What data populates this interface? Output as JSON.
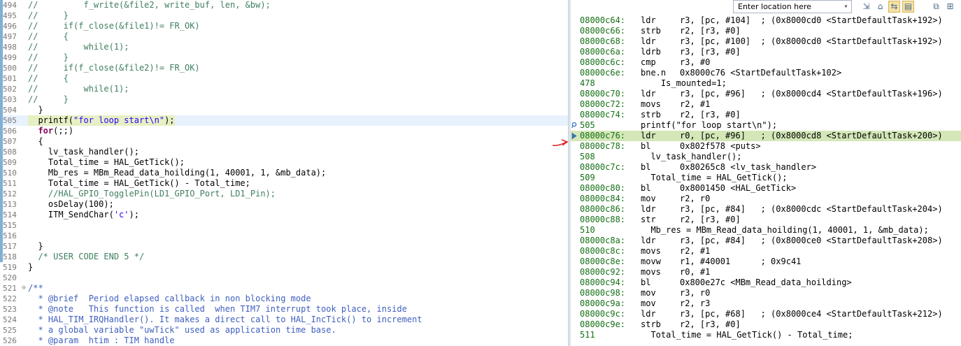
{
  "editor": {
    "lines": [
      {
        "n": "494",
        "bar": true,
        "parts": [
          {
            "c": "cm",
            "t": "//"
          },
          {
            "c": "cm",
            "t": "         f_write(&file2, write_buf, len, &bw);"
          }
        ]
      },
      {
        "n": "495",
        "bar": true,
        "parts": [
          {
            "c": "cm",
            "t": "//     }"
          }
        ]
      },
      {
        "n": "496",
        "bar": true,
        "parts": [
          {
            "c": "cm",
            "t": "//     if(f_close(&file1)!= FR_OK)"
          }
        ]
      },
      {
        "n": "497",
        "bar": true,
        "parts": [
          {
            "c": "cm",
            "t": "//     {"
          }
        ]
      },
      {
        "n": "498",
        "bar": true,
        "parts": [
          {
            "c": "cm",
            "t": "//         while(1);"
          }
        ]
      },
      {
        "n": "499",
        "bar": true,
        "parts": [
          {
            "c": "cm",
            "t": "//     }"
          }
        ]
      },
      {
        "n": "500",
        "bar": true,
        "parts": [
          {
            "c": "cm",
            "t": "//     if(f_close(&file2)!= FR_OK)"
          }
        ]
      },
      {
        "n": "501",
        "bar": true,
        "parts": [
          {
            "c": "cm",
            "t": "//     {"
          }
        ]
      },
      {
        "n": "502",
        "bar": true,
        "parts": [
          {
            "c": "cm",
            "t": "//         while(1);"
          }
        ]
      },
      {
        "n": "503",
        "bar": true,
        "parts": [
          {
            "c": "cm",
            "t": "//     }"
          }
        ]
      },
      {
        "n": "504",
        "bar": true,
        "parts": [
          {
            "c": "plain",
            "t": "  }"
          }
        ]
      },
      {
        "n": "505",
        "bar": true,
        "current": true,
        "parts": [
          {
            "c": "plain",
            "t": "  printf("
          },
          {
            "c": "str",
            "t": "\"for loop start\\n\""
          },
          {
            "c": "plain",
            "t": ");"
          }
        ]
      },
      {
        "n": "506",
        "bar": true,
        "parts": [
          {
            "c": "plain",
            "t": "  "
          },
          {
            "c": "kw",
            "t": "for"
          },
          {
            "c": "plain",
            "t": "(;;)"
          }
        ]
      },
      {
        "n": "507",
        "bar": true,
        "parts": [
          {
            "c": "plain",
            "t": "  {"
          }
        ]
      },
      {
        "n": "508",
        "bar": true,
        "parts": [
          {
            "c": "plain",
            "t": "    lv_task_handler();"
          }
        ]
      },
      {
        "n": "509",
        "bar": true,
        "parts": [
          {
            "c": "plain",
            "t": "    Total_time = HAL_GetTick();"
          }
        ]
      },
      {
        "n": "510",
        "bar": true,
        "parts": [
          {
            "c": "plain",
            "t": "    Mb_res = MBm_Read_data_hoilding(1, 40001, 1, &mb_data);"
          }
        ]
      },
      {
        "n": "511",
        "bar": true,
        "parts": [
          {
            "c": "plain",
            "t": "    Total_time = HAL_GetTick() - Total_time;"
          }
        ]
      },
      {
        "n": "512",
        "bar": true,
        "parts": [
          {
            "c": "cm",
            "t": "    //HAL_GPIO_TogglePin(LD1_GPIO_Port, LD1_Pin);"
          }
        ]
      },
      {
        "n": "513",
        "bar": true,
        "parts": [
          {
            "c": "plain",
            "t": "    osDelay(100);"
          }
        ]
      },
      {
        "n": "514",
        "bar": true,
        "parts": [
          {
            "c": "plain",
            "t": "    ITM_SendChar("
          },
          {
            "c": "str",
            "t": "'c'"
          },
          {
            "c": "plain",
            "t": ");"
          }
        ]
      },
      {
        "n": "515",
        "bar": true,
        "parts": [
          {
            "c": "plain",
            "t": ""
          }
        ]
      },
      {
        "n": "516",
        "bar": true,
        "parts": [
          {
            "c": "plain",
            "t": ""
          }
        ]
      },
      {
        "n": "517",
        "bar": true,
        "parts": [
          {
            "c": "plain",
            "t": "  }"
          }
        ]
      },
      {
        "n": "518",
        "bar": true,
        "parts": [
          {
            "c": "cm",
            "t": "  /* USER CODE END 5 */"
          }
        ]
      },
      {
        "n": "519",
        "bar": false,
        "parts": [
          {
            "c": "plain",
            "t": "}"
          }
        ]
      },
      {
        "n": "520",
        "bar": false,
        "parts": [
          {
            "c": "plain",
            "t": ""
          }
        ]
      },
      {
        "n": "521",
        "bar": false,
        "fold": "⊖",
        "parts": [
          {
            "c": "doc",
            "t": "/**"
          }
        ]
      },
      {
        "n": "522",
        "bar": false,
        "parts": [
          {
            "c": "doc",
            "t": "  * @brief  Period elapsed callback in non blocking mode"
          }
        ]
      },
      {
        "n": "523",
        "bar": false,
        "parts": [
          {
            "c": "doc",
            "t": "  * @note   This function is called  when TIM7 interrupt took place, inside"
          }
        ]
      },
      {
        "n": "524",
        "bar": false,
        "parts": [
          {
            "c": "doc",
            "t": "  * HAL_TIM_IRQHandler(). It makes a direct call to HAL_IncTick() to increment"
          }
        ]
      },
      {
        "n": "525",
        "bar": false,
        "parts": [
          {
            "c": "doc",
            "t": "  * a global variable \"uwTick\" used as application time base."
          }
        ]
      },
      {
        "n": "526",
        "bar": false,
        "parts": [
          {
            "c": "doc",
            "t": "  * @param  htim : TIM handle"
          }
        ]
      }
    ]
  },
  "disasm": {
    "location_placeholder": "Enter location here",
    "toolbar_icons": [
      "goto-address-icon",
      "home-icon",
      "link-with-editor-icon",
      "show-source-icon",
      "new-view-icon",
      "pin-icon"
    ],
    "lines": [
      {
        "type": "asm",
        "addr": "08000c64:",
        "mn": "ldr",
        "ops": "r3, [pc, #104]  ; (0x8000cd0 <StartDefaultTask+192>)"
      },
      {
        "type": "asm",
        "addr": "08000c66:",
        "mn": "strb",
        "ops": "r2, [r3, #0]"
      },
      {
        "type": "asm",
        "addr": "08000c68:",
        "mn": "ldr",
        "ops": "r3, [pc, #100]  ; (0x8000cd0 <StartDefaultTask+192>)"
      },
      {
        "type": "asm",
        "addr": "08000c6a:",
        "mn": "ldrb",
        "ops": "r3, [r3, #0]"
      },
      {
        "type": "asm",
        "addr": "08000c6c:",
        "mn": "cmp",
        "ops": "r3, #0"
      },
      {
        "type": "asm",
        "addr": "08000c6e:",
        "mn": "bne.n",
        "ops": "0x8000c76 <StartDefaultTask+102>"
      },
      {
        "type": "src",
        "num": "478",
        "text": "    Is_mounted=1;"
      },
      {
        "type": "asm",
        "addr": "08000c70:",
        "mn": "ldr",
        "ops": "r3, [pc, #96]   ; (0x8000cd4 <StartDefaultTask+196>)"
      },
      {
        "type": "asm",
        "addr": "08000c72:",
        "mn": "movs",
        "ops": "r2, #1"
      },
      {
        "type": "asm",
        "addr": "08000c74:",
        "mn": "strb",
        "ops": "r2, [r3, #0]"
      },
      {
        "type": "src",
        "num": "505",
        "text": "printf(\"for loop start\\n\");",
        "bp": true
      },
      {
        "type": "asm",
        "addr": "08000c76:",
        "mn": "ldr",
        "ops": "r0, [pc, #96]   ; (0x8000cd8 <StartDefaultTask+200>)",
        "current": true
      },
      {
        "type": "asm",
        "addr": "08000c78:",
        "mn": "bl",
        "ops": "0x802f578 <puts>"
      },
      {
        "type": "src",
        "num": "508",
        "text": "  lv_task_handler();"
      },
      {
        "type": "asm",
        "addr": "08000c7c:",
        "mn": "bl",
        "ops": "0x80265c8 <lv_task_handler>"
      },
      {
        "type": "src",
        "num": "509",
        "text": "  Total_time = HAL_GetTick();"
      },
      {
        "type": "asm",
        "addr": "08000c80:",
        "mn": "bl",
        "ops": "0x8001450 <HAL_GetTick>"
      },
      {
        "type": "asm",
        "addr": "08000c84:",
        "mn": "mov",
        "ops": "r2, r0"
      },
      {
        "type": "asm",
        "addr": "08000c86:",
        "mn": "ldr",
        "ops": "r3, [pc, #84]   ; (0x8000cdc <StartDefaultTask+204>)"
      },
      {
        "type": "asm",
        "addr": "08000c88:",
        "mn": "str",
        "ops": "r2, [r3, #0]"
      },
      {
        "type": "src",
        "num": "510",
        "text": "  Mb_res = MBm_Read_data_hoilding(1, 40001, 1, &mb_data);"
      },
      {
        "type": "asm",
        "addr": "08000c8a:",
        "mn": "ldr",
        "ops": "r3, [pc, #84]   ; (0x8000ce0 <StartDefaultTask+208>)"
      },
      {
        "type": "asm",
        "addr": "08000c8c:",
        "mn": "movs",
        "ops": "r2, #1"
      },
      {
        "type": "asm",
        "addr": "08000c8e:",
        "mn": "movw",
        "ops": "r1, #40001      ; 0x9c41"
      },
      {
        "type": "asm",
        "addr": "08000c92:",
        "mn": "movs",
        "ops": "r0, #1"
      },
      {
        "type": "asm",
        "addr": "08000c94:",
        "mn": "bl",
        "ops": "0x800e27c <MBm_Read_data_hoilding>"
      },
      {
        "type": "asm",
        "addr": "08000c98:",
        "mn": "mov",
        "ops": "r3, r0"
      },
      {
        "type": "asm",
        "addr": "08000c9a:",
        "mn": "mov",
        "ops": "r2, r3"
      },
      {
        "type": "asm",
        "addr": "08000c9c:",
        "mn": "ldr",
        "ops": "r3, [pc, #68]   ; (0x8000ce4 <StartDefaultTask+212>)"
      },
      {
        "type": "asm",
        "addr": "08000c9e:",
        "mn": "strb",
        "ops": "r2, [r3, #0]"
      },
      {
        "type": "src",
        "num": "511",
        "text": "  Total_time = HAL_GetTick() - Total_time;"
      }
    ]
  },
  "colors": {
    "current_line_editor": "#e8f2fe",
    "current_line_disasm": "#d4e7b8",
    "address": "#157016",
    "comment": "#3f7f5f",
    "keyword": "#7f0055",
    "string": "#2a00ff",
    "annotation_arrow": "#e02020"
  }
}
